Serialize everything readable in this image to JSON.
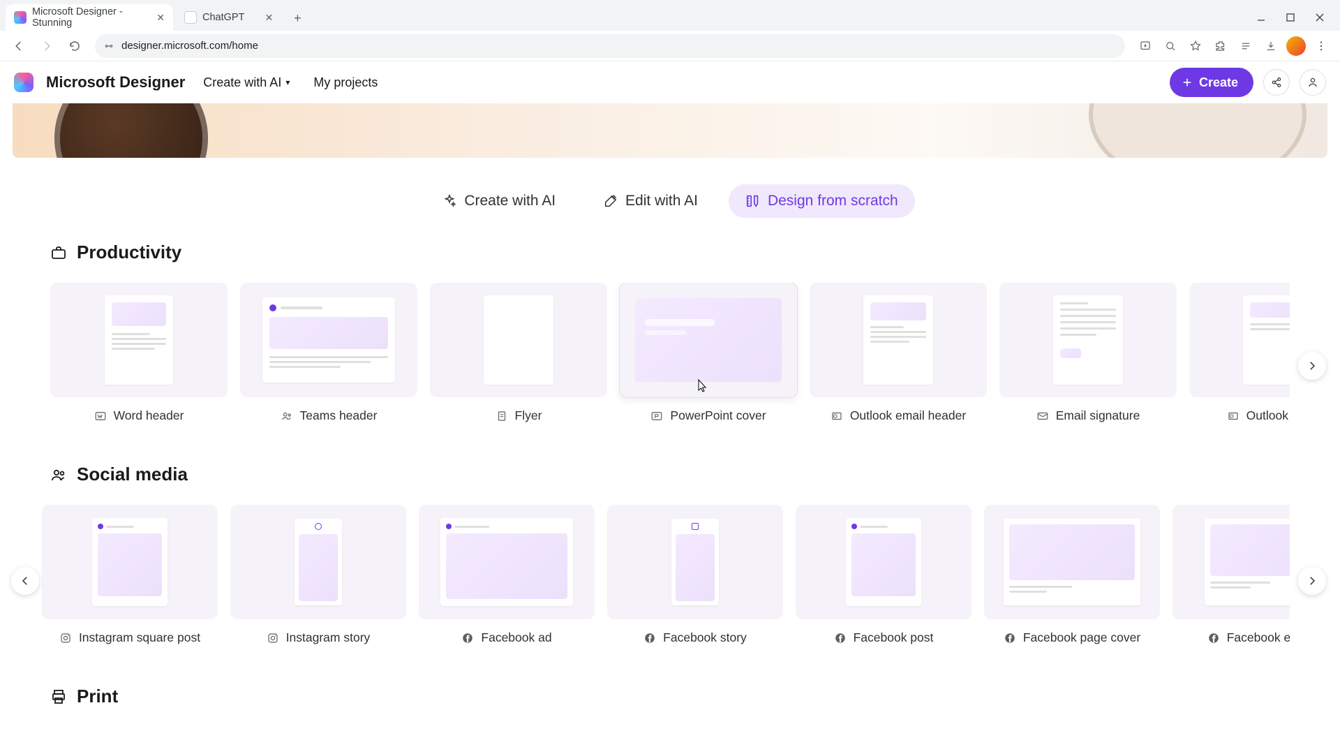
{
  "browser": {
    "tabs": [
      {
        "title": "Microsoft Designer - Stunning"
      },
      {
        "title": "ChatGPT"
      }
    ],
    "url": "designer.microsoft.com/home"
  },
  "header": {
    "brand": "Microsoft Designer",
    "nav": {
      "create_with_ai": "Create with AI",
      "my_projects": "My projects"
    },
    "create_button": "Create"
  },
  "action_tabs": {
    "create_with_ai": "Create with AI",
    "edit_with_ai": "Edit with AI",
    "design_from_scratch": "Design from scratch"
  },
  "sections": {
    "productivity": {
      "title": "Productivity",
      "items": [
        {
          "label": "Word header"
        },
        {
          "label": "Teams header"
        },
        {
          "label": "Flyer"
        },
        {
          "label": "PowerPoint cover"
        },
        {
          "label": "Outlook email header"
        },
        {
          "label": "Email signature"
        },
        {
          "label": "Outlook Eventif"
        }
      ]
    },
    "social": {
      "title": "Social media",
      "items": [
        {
          "label": "Instagram square post"
        },
        {
          "label": "Instagram story"
        },
        {
          "label": "Facebook ad"
        },
        {
          "label": "Facebook story"
        },
        {
          "label": "Facebook post"
        },
        {
          "label": "Facebook page cover"
        },
        {
          "label": "Facebook event"
        }
      ]
    },
    "print": {
      "title": "Print"
    }
  }
}
